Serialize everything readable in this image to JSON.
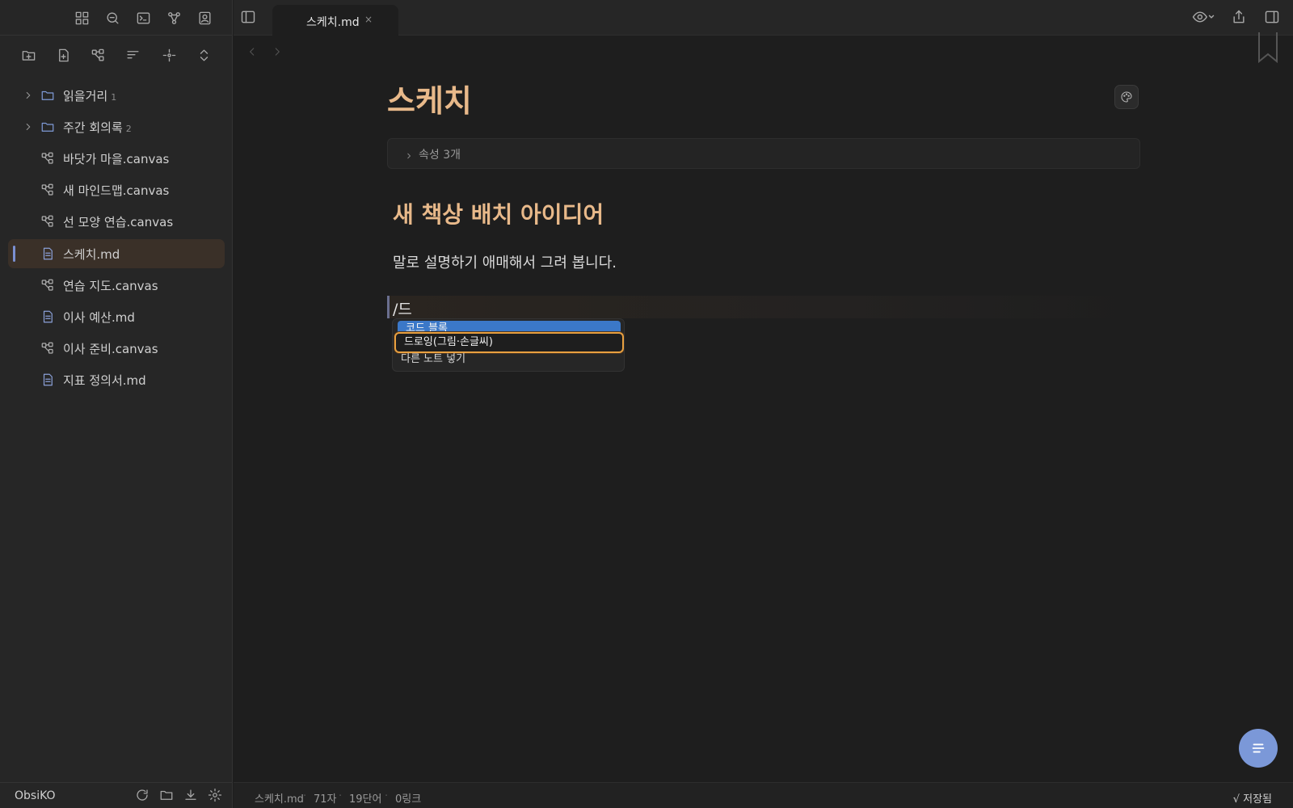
{
  "sidebar": {
    "ribbon_icons": [
      "grid-icon",
      "search-icon",
      "terminal-icon",
      "graph-icon",
      "contact-icon"
    ],
    "toolbar_icons": [
      "new-folder-icon",
      "new-note-icon",
      "new-canvas-icon",
      "sort-icon",
      "reveal-icon",
      "collapse-icon"
    ],
    "items": [
      {
        "label": "읽을거리",
        "type": "folder",
        "count": "1"
      },
      {
        "label": "주간 회의록",
        "type": "folder",
        "count": "2"
      },
      {
        "label": "바닷가 마을.canvas",
        "type": "canvas"
      },
      {
        "label": "새 마인드맵.canvas",
        "type": "canvas"
      },
      {
        "label": "선 모양 연습.canvas",
        "type": "canvas"
      },
      {
        "label": "스케치.md",
        "type": "md",
        "active": true
      },
      {
        "label": "연습 지도.canvas",
        "type": "canvas"
      },
      {
        "label": "이사 예산.md",
        "type": "md"
      },
      {
        "label": "이사 준비.canvas",
        "type": "canvas"
      },
      {
        "label": "지표 정의서.md",
        "type": "md"
      }
    ],
    "vault_name": "ObsiKO",
    "footer_icons": [
      "sync-icon",
      "folder-icon",
      "download-icon",
      "settings-icon"
    ]
  },
  "tabbar": {
    "tab_label": "스케치.md",
    "tab_close": "×"
  },
  "note": {
    "title": "스케치",
    "properties_label": "속성  3개",
    "heading": "새 책상 배치 아이디어",
    "paragraph": "말로 설명하기 애매해서 그려 봅니다.",
    "slash_input": "/드"
  },
  "suggest": {
    "items": [
      "코드 블록",
      "드로잉(그림·손글씨)",
      "다른 노트 넣기"
    ]
  },
  "status": {
    "file": "스케치.md",
    "chars": "71자",
    "words": "19단어",
    "links": "0링크",
    "saved": "√ 저장됨"
  },
  "colors": {
    "accent_heading": "#e8b98a",
    "highlight": "#3b78c8",
    "focus_ring": "#e8a040",
    "fab": "#7b98d8"
  }
}
